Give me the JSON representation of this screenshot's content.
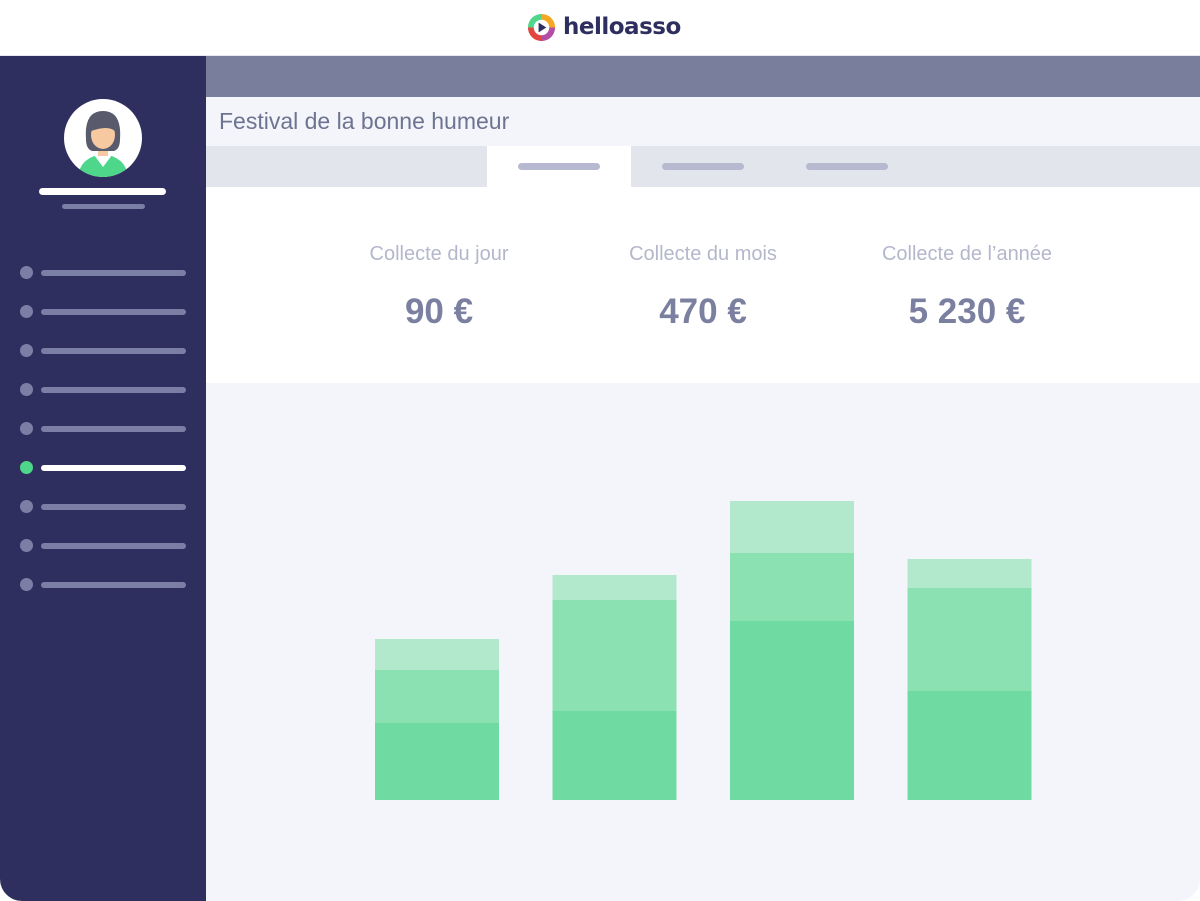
{
  "brand": {
    "name": "helloasso",
    "logo_icon": "helloasso-logo-icon"
  },
  "sidebar": {
    "avatar_icon": "user-avatar-icon",
    "active_index": 5,
    "item_count": 9
  },
  "page": {
    "title": "Festival de la bonne humeur"
  },
  "tabs": {
    "count": 3,
    "active_index": 0
  },
  "stats": [
    {
      "label": "Collecte du jour",
      "value": "90 €"
    },
    {
      "label": "Collecte du mois",
      "value": "470 €"
    },
    {
      "label": "Collecte de l’année",
      "value": "5 230 €"
    }
  ],
  "colors": {
    "sidebar_bg": "#2e2f5e",
    "accent_green": "#4ed68a",
    "bar_dark": "#6fdba2",
    "bar_mid": "#8ce1b2",
    "bar_light": "#b2e9cc"
  },
  "chart_data": {
    "type": "bar",
    "stacked": true,
    "categories": [
      "",
      "",
      "",
      ""
    ],
    "series": [
      {
        "values": [
          77,
          89,
          179,
          109
        ]
      },
      {
        "values": [
          53,
          111,
          68,
          103
        ]
      },
      {
        "values": [
          31,
          25,
          52,
          29
        ]
      }
    ],
    "ylim": [
      0,
      320
    ],
    "grid": false,
    "legend": "none"
  }
}
